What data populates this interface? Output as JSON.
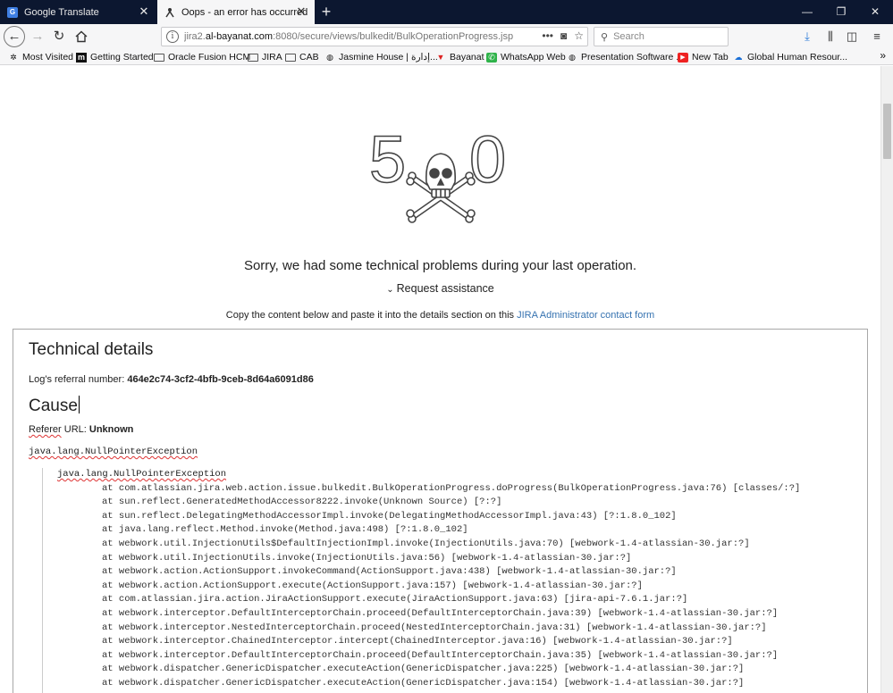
{
  "browser": {
    "tabs": [
      {
        "label": "Google Translate",
        "favicon": "google-translate-icon"
      },
      {
        "label": "Oops - an error has occurred",
        "favicon": "jira-icon",
        "active": true
      }
    ],
    "url": {
      "prefix": "jira2.",
      "host": "al-bayanat.com",
      "path": ":8080/secure/views/bulkedit/BulkOperationProgress.jsp"
    },
    "search_placeholder": "Search",
    "bookmarks": [
      {
        "label": "Most Visited",
        "icon": "gear-icon"
      },
      {
        "label": "Getting Started",
        "icon": "site-icon"
      },
      {
        "label": "Oracle Fusion HCM",
        "icon": "folder-icon"
      },
      {
        "label": "JIRA",
        "icon": "folder-icon"
      },
      {
        "label": "CAB",
        "icon": "folder-icon"
      },
      {
        "label": "Jasmine House | إدارة...",
        "icon": "globe-icon"
      },
      {
        "label": "Bayanat",
        "icon": "bayanat-icon"
      },
      {
        "label": "WhatsApp Web",
        "icon": "whatsapp-icon"
      },
      {
        "label": "Presentation Software ...",
        "icon": "globe-icon"
      },
      {
        "label": "New Tab",
        "icon": "youtube-icon"
      },
      {
        "label": "Global Human Resour...",
        "icon": "cloud-icon"
      }
    ]
  },
  "error": {
    "code_left": "5",
    "code_right": "0",
    "message": "Sorry, we had some technical problems during your last operation.",
    "request_assistance": "Request assistance",
    "copy_text": "Copy the content below and paste it into the details section on this ",
    "copy_link": "JIRA Administrator contact form"
  },
  "details": {
    "title": "Technical details",
    "referral_label": "Log's referral number: ",
    "referral_number": "464e2c74-3cf2-4bfb-9ceb-8d64a6091d86",
    "cause_title": "Cause",
    "referer_label": "Referer",
    "referer_suffix": " URL: ",
    "referer_value": "Unknown",
    "exception": "java.lang.NullPointerException",
    "trace_head": "java.lang.NullPointerException",
    "trace": [
      "at com.atlassian.jira.web.action.issue.bulkedit.BulkOperationProgress.doProgress(BulkOperationProgress.java:76) [classes/:?]",
      "at sun.reflect.GeneratedMethodAccessor8222.invoke(Unknown Source) [?:?]",
      "at sun.reflect.DelegatingMethodAccessorImpl.invoke(DelegatingMethodAccessorImpl.java:43) [?:1.8.0_102]",
      "at java.lang.reflect.Method.invoke(Method.java:498) [?:1.8.0_102]",
      "at webwork.util.InjectionUtils$DefaultInjectionImpl.invoke(InjectionUtils.java:70) [webwork-1.4-atlassian-30.jar:?]",
      "at webwork.util.InjectionUtils.invoke(InjectionUtils.java:56) [webwork-1.4-atlassian-30.jar:?]",
      "at webwork.action.ActionSupport.invokeCommand(ActionSupport.java:438) [webwork-1.4-atlassian-30.jar:?]",
      "at webwork.action.ActionSupport.execute(ActionSupport.java:157) [webwork-1.4-atlassian-30.jar:?]",
      "at com.atlassian.jira.action.JiraActionSupport.execute(JiraActionSupport.java:63) [jira-api-7.6.1.jar:?]",
      "at webwork.interceptor.DefaultInterceptorChain.proceed(DefaultInterceptorChain.java:39) [webwork-1.4-atlassian-30.jar:?]",
      "at webwork.interceptor.NestedInterceptorChain.proceed(NestedInterceptorChain.java:31) [webwork-1.4-atlassian-30.jar:?]",
      "at webwork.interceptor.ChainedInterceptor.intercept(ChainedInterceptor.java:16) [webwork-1.4-atlassian-30.jar:?]",
      "at webwork.interceptor.DefaultInterceptorChain.proceed(DefaultInterceptorChain.java:35) [webwork-1.4-atlassian-30.jar:?]",
      "at webwork.dispatcher.GenericDispatcher.executeAction(GenericDispatcher.java:225) [webwork-1.4-atlassian-30.jar:?]",
      "at webwork.dispatcher.GenericDispatcher.executeAction(GenericDispatcher.java:154) [webwork-1.4-atlassian-30.jar:?]"
    ]
  },
  "colors": {
    "tabbar": "#0c1730",
    "link": "#3572b0",
    "spellcheck": "#dd3333"
  }
}
